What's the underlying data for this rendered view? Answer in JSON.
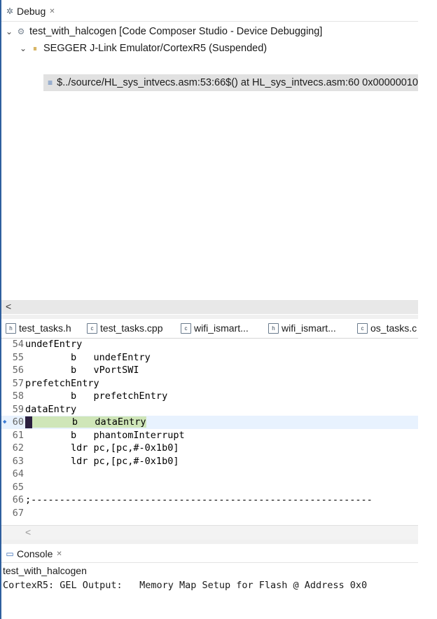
{
  "debug_view": {
    "tab_label": "Debug",
    "close_glyph": "✕",
    "tree": [
      {
        "label": "test_with_halcogen [Code Composer Studio - Device Debugging]",
        "icon": "launch-config-icon"
      },
      {
        "label": "SEGGER J-Link Emulator/CortexR5 (Suspended)",
        "icon": "thread-suspended-icon"
      },
      {
        "label": "$../source/HL_sys_intvecs.asm:53:66$() at HL_sys_intvecs.asm:60 0x00000010",
        "icon": "stack-frame-icon"
      }
    ],
    "scroll_left": "<"
  },
  "editor": {
    "tabs": [
      {
        "label": "test_tasks.h",
        "icon": "h"
      },
      {
        "label": "test_tasks.cpp",
        "icon": "c"
      },
      {
        "label": "wifi_ismart...",
        "icon": "c"
      },
      {
        "label": "wifi_ismart...",
        "icon": "h"
      },
      {
        "label": "os_tasks.c",
        "icon": "c"
      }
    ],
    "lines": [
      {
        "num": "54",
        "text": "undefEntry"
      },
      {
        "num": "55",
        "text": "        b   undefEntry"
      },
      {
        "num": "56",
        "text": "        b   vPortSWI"
      },
      {
        "num": "57",
        "text": "prefetchEntry"
      },
      {
        "num": "58",
        "text": "        b   prefetchEntry"
      },
      {
        "num": "59",
        "text": "dataEntry"
      },
      {
        "num": "60",
        "text_pre": "       b   ",
        "text_hl": "dataEntry"
      },
      {
        "num": "61",
        "text": "        b   phantomInterrupt"
      },
      {
        "num": "62",
        "text": "        ldr pc,[pc,#-0x1b0]"
      },
      {
        "num": "63",
        "text": "        ldr pc,[pc,#-0x1b0]"
      },
      {
        "num": "64",
        "text": ""
      },
      {
        "num": "65",
        "text": ""
      },
      {
        "num": "66",
        "text": ";------------------------------------------------------------"
      },
      {
        "num": "67",
        "text": ""
      }
    ],
    "current_line": "60",
    "scroll_left": "<"
  },
  "console": {
    "tab_label": "Console",
    "close_glyph": "✕",
    "session": "test_with_halcogen",
    "output": "CortexR5: GEL Output:   Memory Map Setup for Flash @ Address 0x0"
  },
  "colors": {
    "selection": "#e1e1e1",
    "current_line": "#e8f2fe",
    "pc_highlight": "#cfe6b8",
    "frame": "#2f5f9e"
  }
}
